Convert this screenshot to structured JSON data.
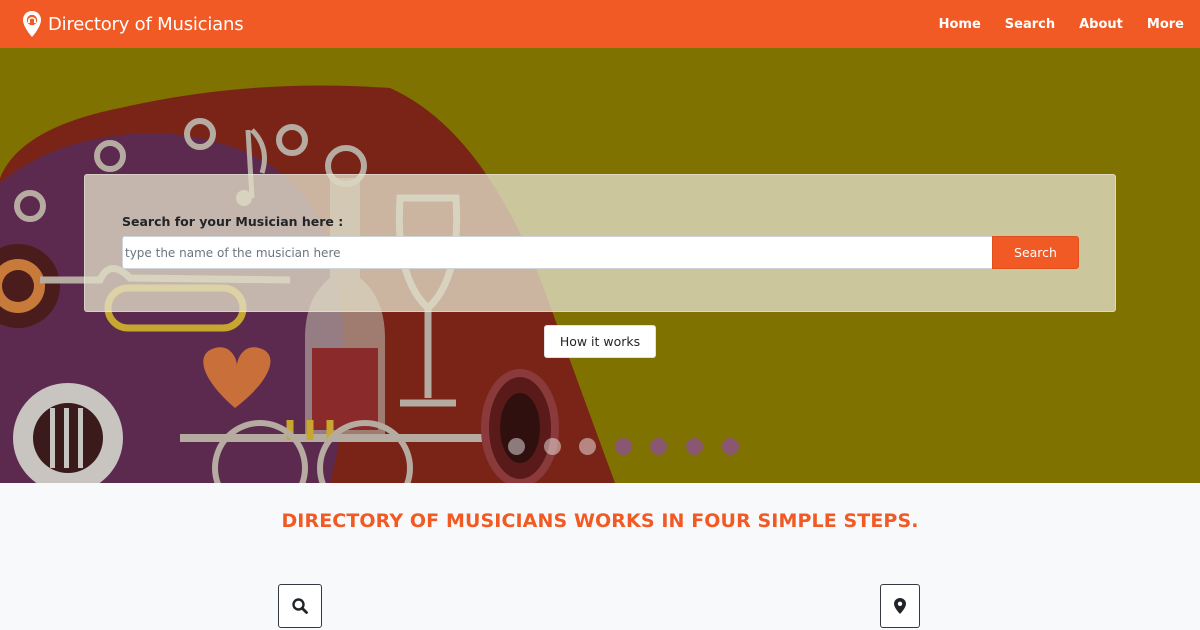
{
  "navbar": {
    "brand": "Directory of Musicians",
    "brand_icon": "map-pin-music-icon",
    "links": [
      "Home",
      "Search",
      "About",
      "More"
    ],
    "background": "#f15a24"
  },
  "hero": {
    "background": "#807200",
    "search_label": "Search for your Musician here :",
    "search_placeholder": "type the name of the musician here",
    "search_button": "Search",
    "how_button": "How it works",
    "carousel_dots": 7
  },
  "steps": {
    "title": "DIRECTORY OF MUSICIANS WORKS IN FOUR SIMPLE STEPS.",
    "icons": [
      "search-icon",
      "map-marker-icon"
    ]
  },
  "accent": "#f15a24"
}
